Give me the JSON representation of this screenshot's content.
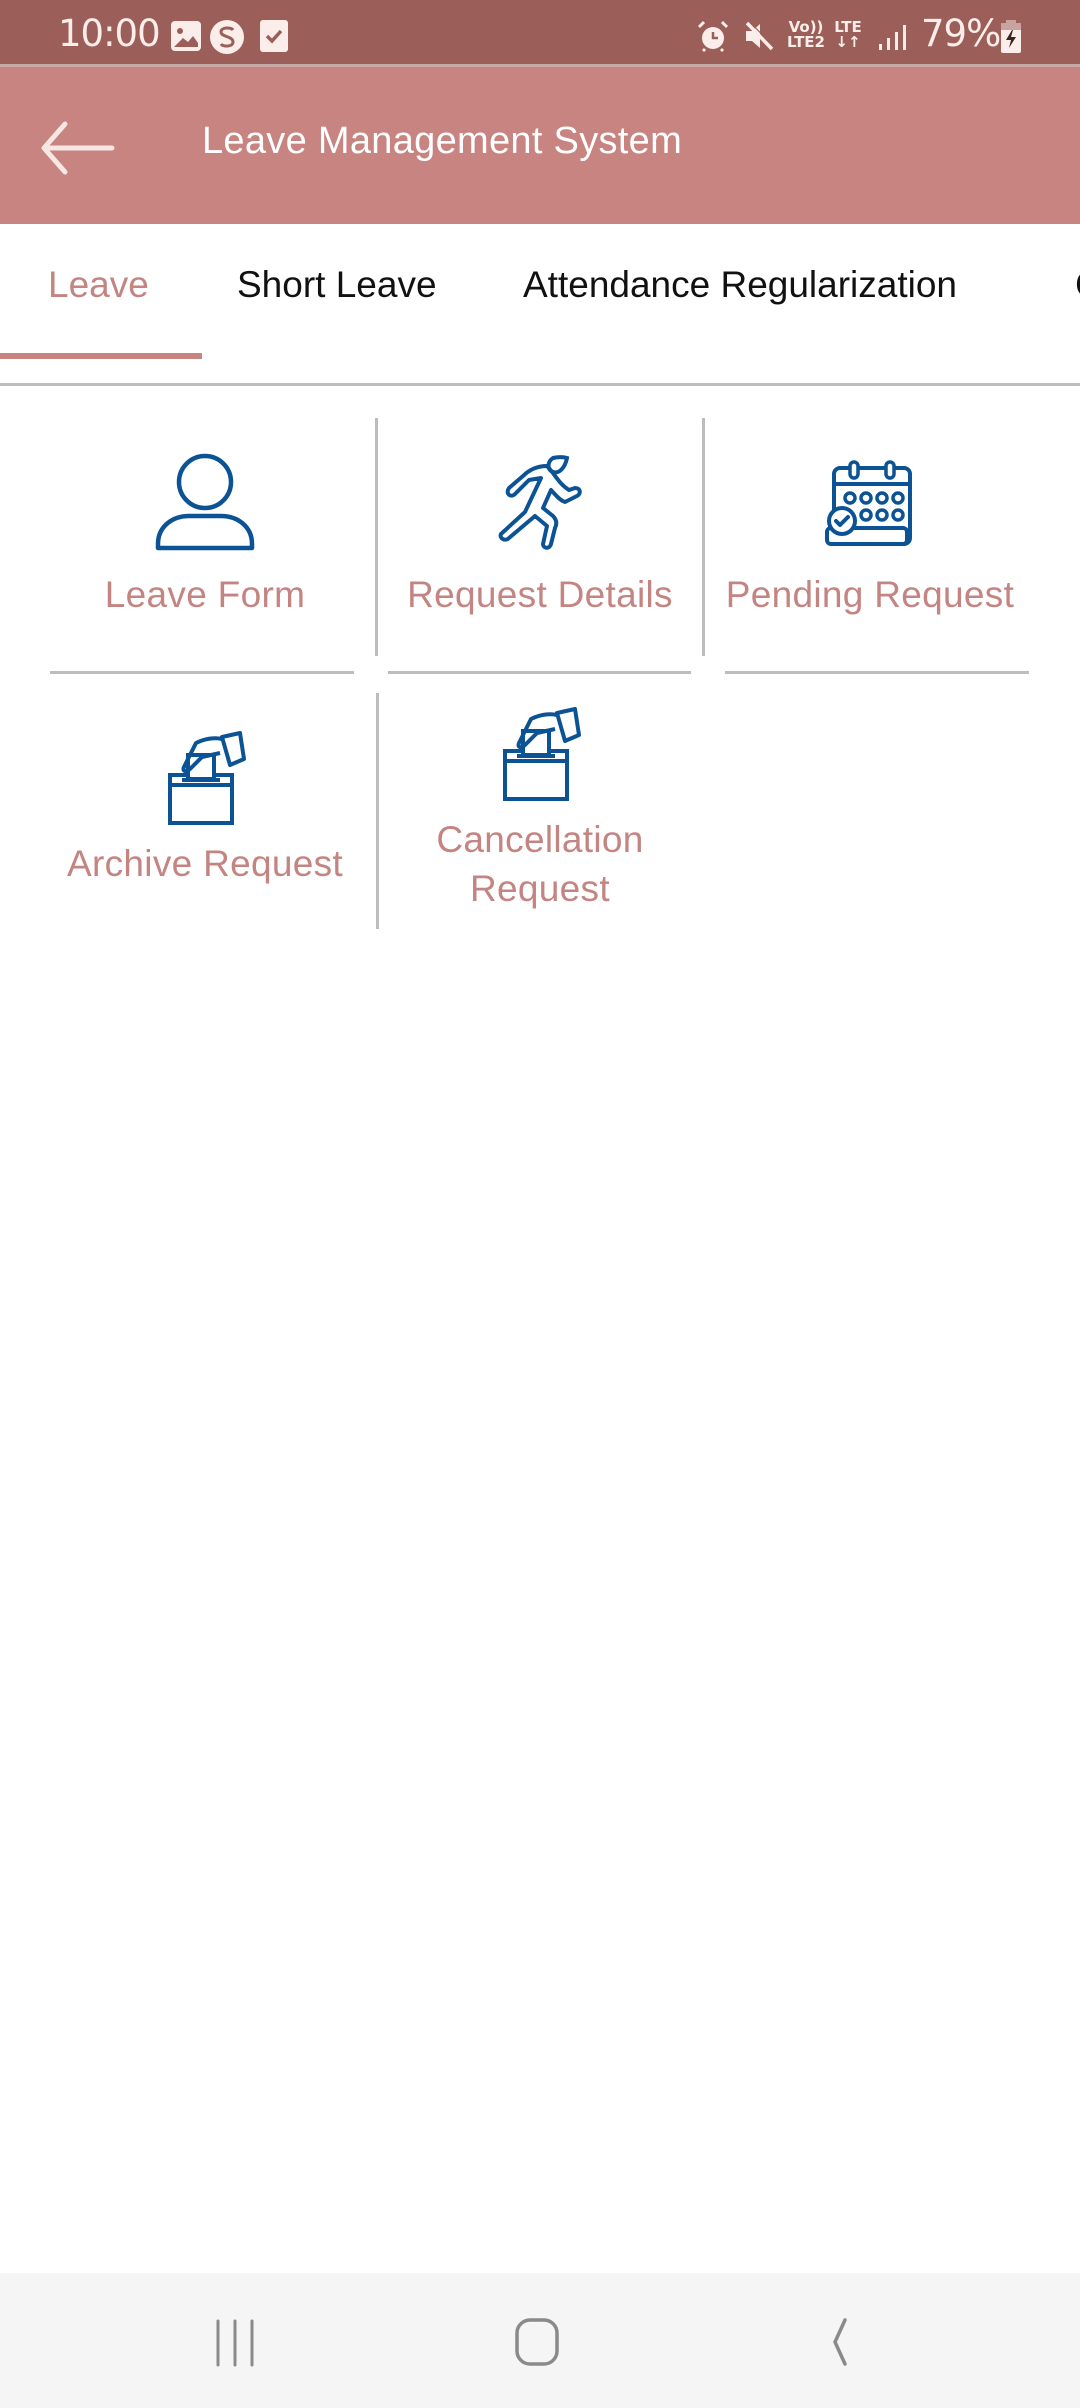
{
  "status_bar": {
    "time": "10:00",
    "left_icons": [
      "gallery-icon",
      "s-app-icon",
      "checkbox-app-icon"
    ],
    "right_icons": [
      "alarm-icon",
      "mute-icon",
      "volte-icon",
      "lte-data-icon",
      "signal-icon",
      "battery-charging-icon"
    ],
    "volte_top": "Vo))",
    "volte_bottom": "LTE2",
    "lte_label": "LTE",
    "lte_arrows": "↓↑",
    "battery_percent": "79%"
  },
  "app_bar": {
    "back_icon": "arrow-left-icon",
    "title": "Leave Management System"
  },
  "tabs": {
    "active_index": 0,
    "items": [
      {
        "label": "Leave"
      },
      {
        "label": "Short Leave"
      },
      {
        "label": "Attendance Regularization"
      },
      {
        "label": "C"
      }
    ]
  },
  "grid": {
    "items": [
      {
        "label": "Leave Form",
        "icon": "user-icon"
      },
      {
        "label": "Request Details",
        "icon": "running-person-icon"
      },
      {
        "label": "Pending Request",
        "icon": "calendar-check-icon"
      },
      {
        "label": "Archive Request",
        "icon": "ballot-box-icon"
      },
      {
        "label_line1": "Cancellation",
        "label_line2": "Request",
        "icon": "ballot-box-icon"
      }
    ]
  },
  "colors": {
    "status_bar": "#9c5e58",
    "app_bar": "#c78481",
    "accent_text": "#c48481",
    "icon_blue": "#0b5394",
    "divider": "#bdbdbd",
    "nav_bar": "#f5f5f5"
  },
  "nav_bar": {
    "buttons": [
      "recent-apps-icon",
      "home-icon",
      "back-icon"
    ]
  }
}
